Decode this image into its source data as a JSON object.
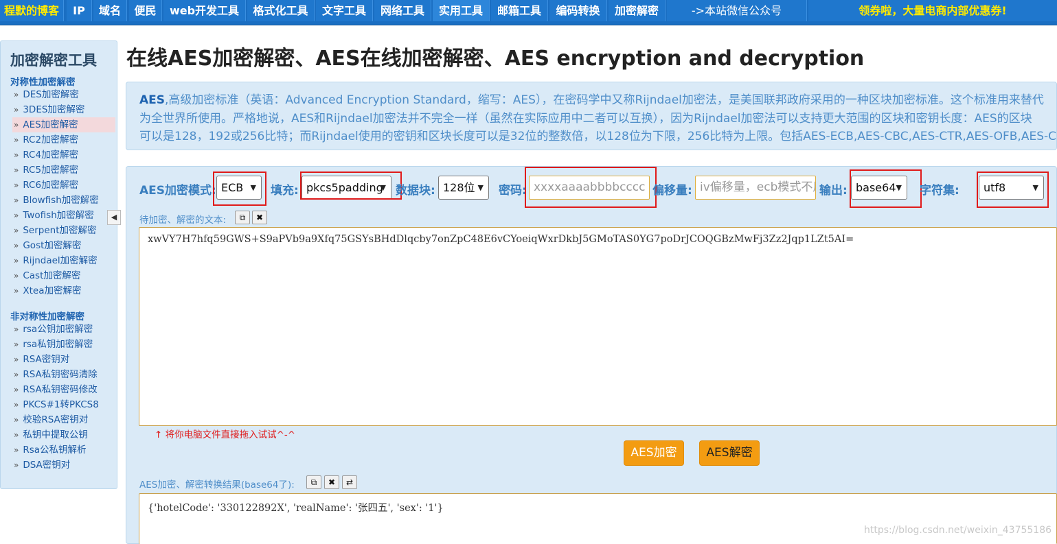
{
  "nav": {
    "items": [
      {
        "label": "程默的博客"
      },
      {
        "label": "IP"
      },
      {
        "label": "域名"
      },
      {
        "label": "便民"
      },
      {
        "label": "web开发工具"
      },
      {
        "label": "格式化工具"
      },
      {
        "label": "文字工具"
      },
      {
        "label": "网络工具"
      },
      {
        "label": "实用工具"
      },
      {
        "label": "邮箱工具"
      },
      {
        "label": "编码转换"
      },
      {
        "label": "加密解密"
      },
      {
        "label": "->本站微信公众号"
      }
    ],
    "promo": "领券啦，大量电商内部优惠券!",
    "colors": {
      "bg": "#1a6ec2",
      "brand": "#ffea00"
    }
  },
  "sidebar": {
    "title": "加密解密工具",
    "symmetric_title": "对称性加密解密",
    "symmetric_items": [
      "DES加密解密",
      "3DES加密解密",
      "AES加密解密",
      "RC2加密解密",
      "RC4加密解密",
      "RC5加密解密",
      "RC6加密解密",
      "Blowfish加密解密",
      "Twofish加密解密",
      "Serpent加密解密",
      "Gost加密解密",
      "Rijndael加密解密",
      "Cast加密解密",
      "Xtea加密解密"
    ],
    "asymmetric_title": "非对称性加密解密",
    "asymmetric_items": [
      "rsa公钥加密解密",
      "rsa私钥加密解密",
      "RSA密钥对",
      "RSA私钥密码清除",
      "RSA私钥密码修改",
      "PKCS#1转PKCS8",
      "校验RSA密钥对",
      "私钥中提取公钥",
      "Rsa公私钥解析",
      "DSA密钥对"
    ],
    "active": "AES加密解密",
    "collapse_icon": "◀"
  },
  "main": {
    "title": "在线AES加密解密、AES在线加密解密、AES encryption and decryption",
    "intro": {
      "lead": "AES",
      "line1": ",高级加密标准（英语：Advanced Encryption Standard，缩写：AES），在密码学中又称Rijndael加密法，是美国联邦政府采用的一种区块加密标准。这个标准用来替代",
      "line2": "为全世界所使用。严格地说，AES和Rijndael加密法并不完全一样（虽然在实际应用中二者可以互换），因为Rijndael加密法可以支持更大范围的区块和密钥长度：AES的区块",
      "line3": "可以是128，192或256比特；而Rijndael使用的密钥和区块长度可以是32位的整数倍，以128位为下限，256比特为上限。包括AES-ECB,AES-CBC,AES-CTR,AES-OFB,AES-C"
    },
    "options": {
      "mode_label": "AES加密模式:",
      "mode_value": "ECB",
      "padding_label": "填充:",
      "padding_value": "pkcs5padding",
      "block_label": "数据块:",
      "block_value": "128位",
      "password_label": "密码:",
      "password_placeholder": "xxxxaaaabbbbcccc",
      "iv_label": "偏移量:",
      "iv_placeholder": "iv偏移量，ecb模式不用填写",
      "output_label": "输出:",
      "output_value": "base64",
      "charset_label": "字符集:",
      "charset_value": "utf8"
    },
    "input": {
      "label": "待加密、解密的文本:",
      "value": "xwVY7H7hfq59GWS+S9aPVb9a9Xfq75GSYsBHdDlqcby7onZpC48E6vCYoeiqWxrDkbJ5GMoTAS0YG7poDrJCOQGBzMwFj3Zz2Jqp1LZt5AI="
    },
    "drag_hint": "↑ 将你电脑文件直接拖入试试^-^",
    "encrypt_label": "AES加密",
    "decrypt_label": "AES解密",
    "output": {
      "label": "AES加密、解密转换结果(base64了):",
      "value": "{'hotelCode': '330122892X', 'realName': '张四五', 'sex': '1'}"
    },
    "icons": {
      "copy": "⧉",
      "clear": "✖",
      "swap": "⇄"
    }
  },
  "watermark": "https://blog.csdn.net/weixin_43755186"
}
